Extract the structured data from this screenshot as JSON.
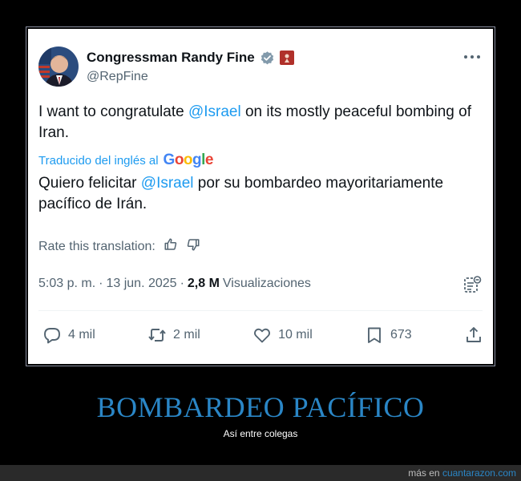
{
  "tweet": {
    "author_name": "Congressman Randy Fine",
    "handle": "@RepFine",
    "text_before": "I want to congratulate ",
    "mention": "@Israel",
    "text_after": " on its mostly peaceful bombing of Iran.",
    "translated_by_label": "Traducido del inglés al",
    "translator_brand": "Google",
    "translation_before": "Quiero felicitar ",
    "translation_mention": "@Israel",
    "translation_after": " por su bombardeo mayoritariamente pacífico de Irán.",
    "rate_label": "Rate this translation:",
    "time": "5:03 p. m.",
    "separator": "·",
    "date": "13 jun. 2025",
    "views_count": "2,8 M",
    "views_label": "Visualizaciones",
    "actions": {
      "replies": "4 mil",
      "reposts": "2 mil",
      "likes": "10 mil",
      "bookmarks": "673"
    }
  },
  "meme": {
    "headline": "BOMBARDEO PACÍFICO",
    "subline": "Así entre colegas"
  },
  "footer": {
    "prefix": "más en",
    "site": "cuantarazon.com"
  },
  "colors": {
    "accent_blue": "#1d9bf0",
    "headline_blue": "#2a86c6",
    "text_primary": "#0f1419",
    "text_secondary": "#536471"
  },
  "icons": [
    "verified-badge-icon",
    "government-flag-icon",
    "more-options-icon",
    "thumbs-up-icon",
    "thumbs-down-icon",
    "community-notes-icon",
    "reply-icon",
    "repost-icon",
    "like-icon",
    "bookmark-icon",
    "share-icon"
  ]
}
